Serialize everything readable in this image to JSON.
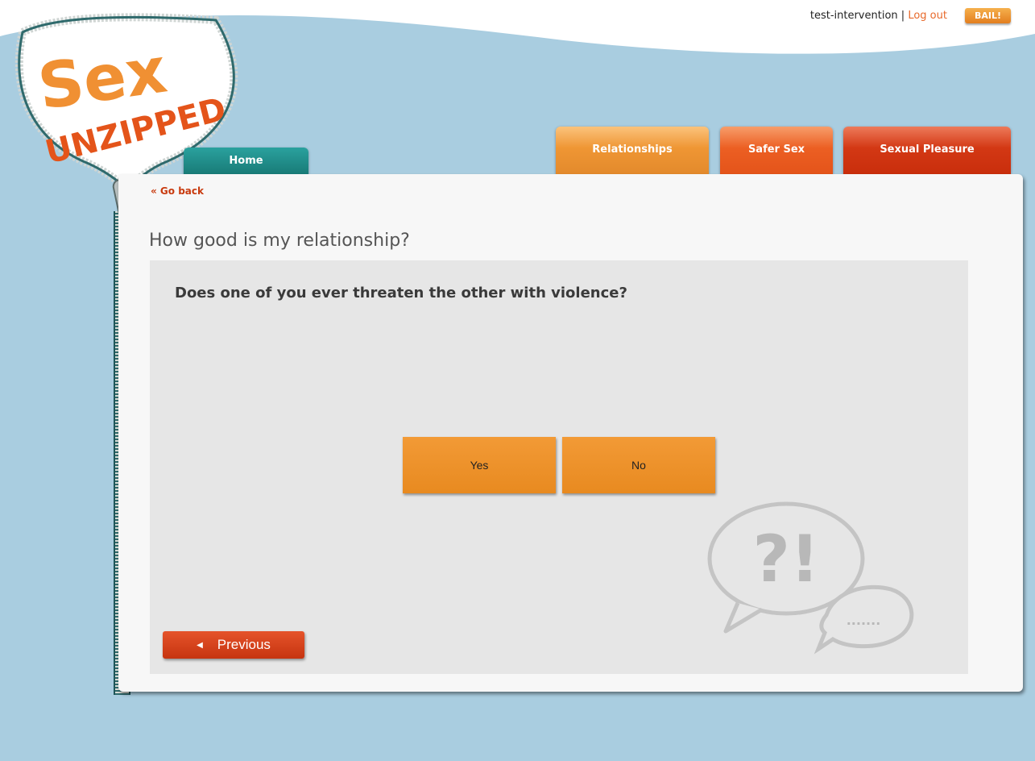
{
  "header": {
    "username": "test-intervention",
    "separator": "|",
    "logout_label": "Log out",
    "bail_label": "BAIL!"
  },
  "logo": {
    "word1": "Sex",
    "word2": "UNZIPPED"
  },
  "nav": {
    "home": "Home",
    "relationships": "Relationships",
    "safer_sex": "Safer Sex",
    "sexual_pleasure": "Sexual Pleasure"
  },
  "content": {
    "go_back": "« Go back",
    "page_title": "How good is my relationship?",
    "question": "Does one of you ever threaten the other with violence?",
    "answers": [
      "Yes",
      "No"
    ],
    "previous_label": "Previous",
    "bubble_marks": "?!",
    "bubble_dots": "......."
  },
  "colors": {
    "background": "#a9cde0",
    "accent_orange": "#e88a20",
    "accent_red": "#c83a0e",
    "teal": "#1e7a77"
  },
  "icons": {
    "previous_arrow": "triangle-left-icon",
    "speech_bubble": "speech-bubble-icon"
  }
}
